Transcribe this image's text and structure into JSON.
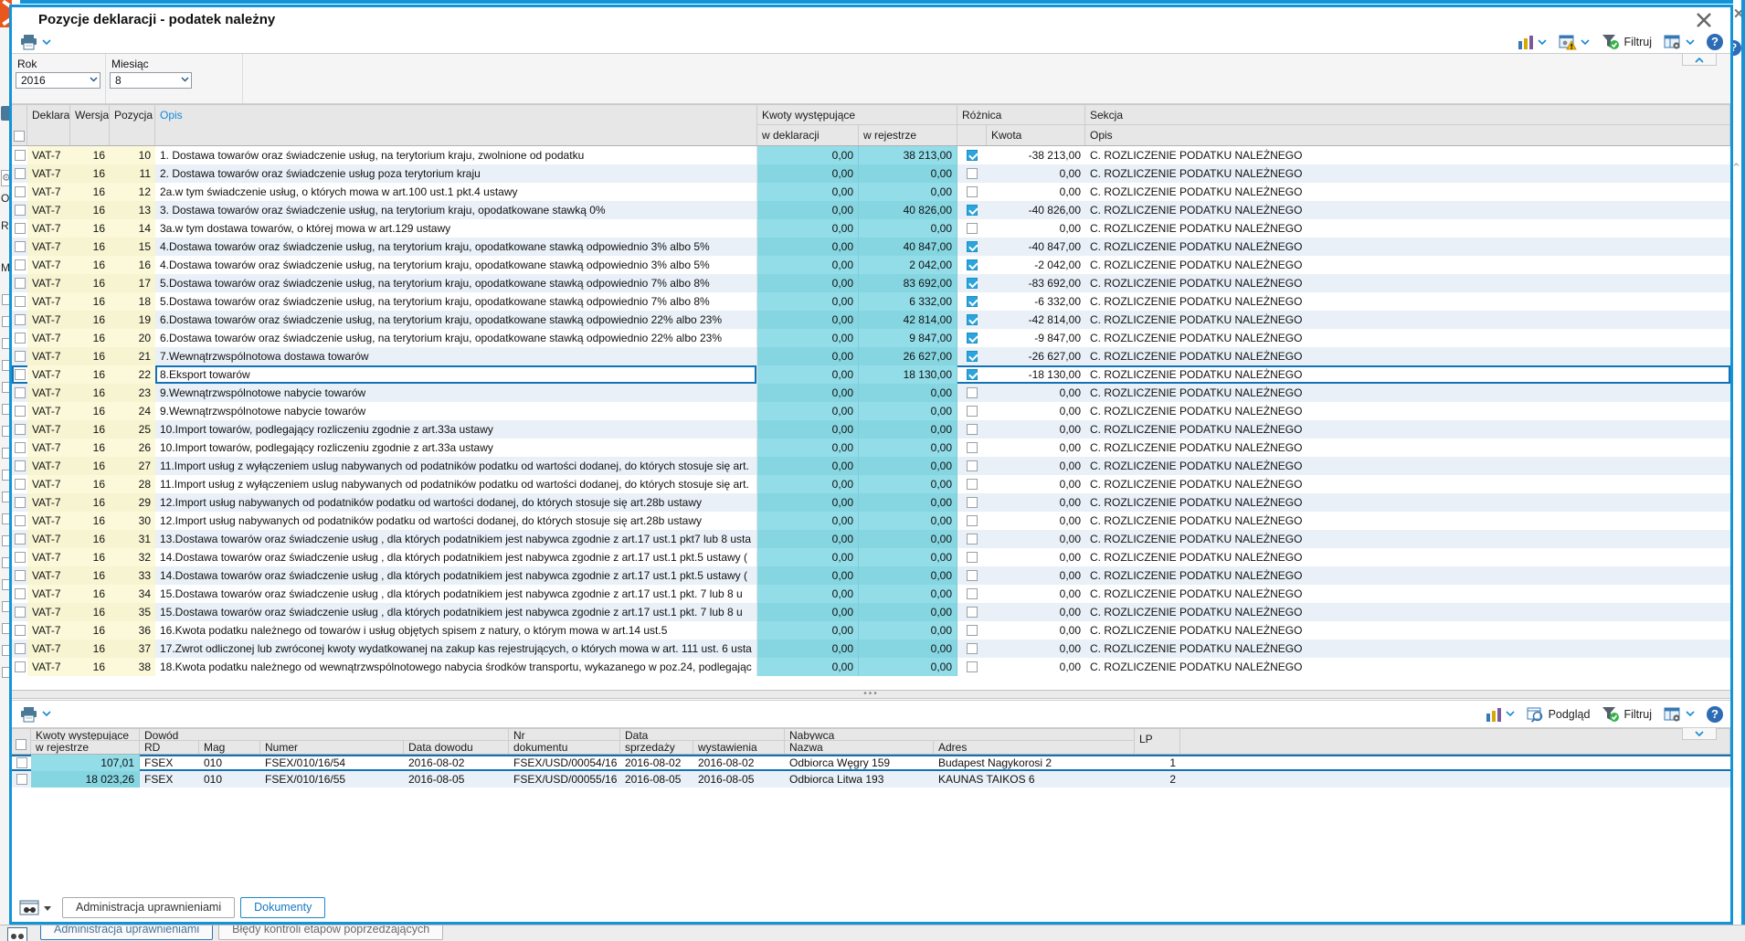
{
  "window": {
    "title": "Pozycje deklaracji - podatek należny"
  },
  "filters": {
    "year_label": "Rok",
    "year_value": "2016",
    "month_label": "Miesiąc",
    "month_value": "8"
  },
  "toolbar_top": {
    "filter_label": "Filtruj",
    "help_glyph": "?"
  },
  "toolbar_bottom": {
    "preview_label": "Podgląd",
    "filter_label": "Filtruj",
    "help_glyph": "?"
  },
  "main_table": {
    "headers": {
      "declaration": "Deklaracja",
      "version": "Wersja",
      "position": "Pozycja",
      "description": "Opis",
      "amounts_group": "Kwoty występujące",
      "in_declaration": "w deklaracji",
      "in_register": "w rejestrze",
      "difference_group": "Różnica",
      "amount": "Kwota",
      "section_group": "Sekcja",
      "section_desc": "Opis"
    },
    "defaults": {
      "declaration": "VAT-7",
      "version": "16",
      "in_declaration": "0,00",
      "section": "C. ROZLICZENIE PODATKU NALEŻNEGO"
    },
    "rows": [
      {
        "position": "10",
        "desc": "1. Dostawa towarów oraz świadczenie usług, na terytorium kraju, zwolnione od podatku",
        "in_register": "38 213,00",
        "checked": true,
        "difference": "-38 213,00"
      },
      {
        "position": "11",
        "desc": "2. Dostawa towarów oraz świadczenie usług poza terytorium  kraju",
        "in_register": "0,00",
        "checked": false,
        "difference": "0,00"
      },
      {
        "position": "12",
        "desc": "2a.w tym świadczenie usług, o których mowa w art.100  ust.1 pkt.4 ustawy",
        "in_register": "0,00",
        "checked": false,
        "difference": "0,00"
      },
      {
        "position": "13",
        "desc": "3. Dostawa towarów oraz świadczenie usług, na terytorium kraju, opodatkowane stawką 0%",
        "in_register": "40 826,00",
        "checked": true,
        "difference": "-40 826,00"
      },
      {
        "position": "14",
        "desc": "3a.w tym dostawa towarów, o której mowa w art.129 ustawy",
        "in_register": "0,00",
        "checked": false,
        "difference": "0,00"
      },
      {
        "position": "15",
        "desc": "4.Dostawa towarów oraz świadczenie usług, na terytorium kraju,  opodatkowane stawką odpowiednio 3% albo 5%",
        "in_register": "40 847,00",
        "checked": true,
        "difference": "-40 847,00"
      },
      {
        "position": "16",
        "desc": "4.Dostawa towarów oraz świadczenie usług, na terytorium kraju,  opodatkowane stawką odpowiednio 3% albo 5%",
        "in_register": "2 042,00",
        "checked": true,
        "difference": "-2 042,00"
      },
      {
        "position": "17",
        "desc": "5.Dostawa towarów oraz świadczenie usług, na terytorium kraju,  opodatkowane stawką odpowiednio 7% albo 8%",
        "in_register": "83 692,00",
        "checked": true,
        "difference": "-83 692,00"
      },
      {
        "position": "18",
        "desc": "5.Dostawa towarów oraz świadczenie usług, na terytorium kraju,  opodatkowane stawką odpowiednio 7% albo 8%",
        "in_register": "6 332,00",
        "checked": true,
        "difference": "-6 332,00"
      },
      {
        "position": "19",
        "desc": "6.Dostawa towarów oraz świadczenie usług, na terytorium kraju,  opodatkowane stawką odpowiednio 22% albo 23%",
        "in_register": "42 814,00",
        "checked": true,
        "difference": "-42 814,00"
      },
      {
        "position": "20",
        "desc": "6.Dostawa towarów oraz świadczenie usług, na terytorium kraju,  opodatkowane stawką odpowiednio 22% albo 23%",
        "in_register": "9 847,00",
        "checked": true,
        "difference": "-9 847,00"
      },
      {
        "position": "21",
        "desc": "7.Wewnątrzwspólnotowa dostawa towarów",
        "in_register": "26 627,00",
        "checked": true,
        "difference": "-26 627,00"
      },
      {
        "position": "22",
        "desc": "8.Eksport towarów",
        "in_register": "18 130,00",
        "checked": true,
        "difference": "-18 130,00",
        "selected": true
      },
      {
        "position": "23",
        "desc": "9.Wewnątrzwspólnotowe nabycie towarów",
        "in_register": "0,00",
        "checked": false,
        "difference": "0,00"
      },
      {
        "position": "24",
        "desc": "9.Wewnątrzwspólnotowe nabycie towarów",
        "in_register": "0,00",
        "checked": false,
        "difference": "0,00"
      },
      {
        "position": "25",
        "desc": "10.Import towarów, podlegający rozliczeniu zgodnie z art.33a ustawy",
        "in_register": "0,00",
        "checked": false,
        "difference": "0,00"
      },
      {
        "position": "26",
        "desc": "10.Import towarów, podlegający rozliczeniu zgodnie z art.33a ustawy",
        "in_register": "0,00",
        "checked": false,
        "difference": "0,00"
      },
      {
        "position": "27",
        "desc": "11.Import usług z wyłączeniem uslug nabywanych od podatników podatku od wartości dodanej, do których stosuje się art.",
        "in_register": "0,00",
        "checked": false,
        "difference": "0,00"
      },
      {
        "position": "28",
        "desc": "11.Import usług z wyłączeniem uslug nabywanych od podatników podatku od wartości dodanej, do których stosuje się art.",
        "in_register": "0,00",
        "checked": false,
        "difference": "0,00"
      },
      {
        "position": "29",
        "desc": "12.Import usług nabywanych od podatników podatku od wartości dodanej, do których stosuje się art.28b ustawy",
        "in_register": "0,00",
        "checked": false,
        "difference": "0,00"
      },
      {
        "position": "30",
        "desc": "12.Import usług nabywanych od podatników podatku od wartości dodanej, do których stosuje się art.28b ustawy",
        "in_register": "0,00",
        "checked": false,
        "difference": "0,00"
      },
      {
        "position": "31",
        "desc": "13.Dostawa towarów oraz świadczenie usług , dla których podatnikiem jest nabywca  zgodnie z art.17 ust.1 pkt7 lub 8 usta",
        "in_register": "0,00",
        "checked": false,
        "difference": "0,00"
      },
      {
        "position": "32",
        "desc": "14.Dostawa towarów oraz świadczenie usług , dla których podatnikiem jest nabywca  zgodnie z art.17 ust.1 pkt.5 ustawy (",
        "in_register": "0,00",
        "checked": false,
        "difference": "0,00"
      },
      {
        "position": "33",
        "desc": "14.Dostawa towarów oraz świadczenie usług , dla których podatnikiem jest nabywca  zgodnie z art.17 ust.1 pkt.5 ustawy (",
        "in_register": "0,00",
        "checked": false,
        "difference": "0,00"
      },
      {
        "position": "34",
        "desc": "15.Dostawa towarów oraz świadczenie usług , dla których podatnikiem jest nabywca  zgodnie z art.17 ust.1 pkt. 7 lub 8  u",
        "in_register": "0,00",
        "checked": false,
        "difference": "0,00"
      },
      {
        "position": "35",
        "desc": "15.Dostawa towarów oraz świadczenie usług , dla których podatnikiem jest nabywca  zgodnie z art.17 ust.1 pkt. 7 lub 8  u",
        "in_register": "0,00",
        "checked": false,
        "difference": "0,00"
      },
      {
        "position": "36",
        "desc": "16.Kwota podatku należnego od towarów i usług objętych spisem z natury, o którym mowa w art.14 ust.5",
        "in_register": "0,00",
        "checked": false,
        "difference": "0,00"
      },
      {
        "position": "37",
        "desc": "17.Zwrot odliczonej lub zwróconej kwoty wydatkowanej na zakup kas rejestrujących, o których mowa w art. 111 ust. 6 usta",
        "in_register": "0,00",
        "checked": false,
        "difference": "0,00"
      },
      {
        "position": "38",
        "desc": "18.Kwota podatku należnego od wewnątrzwspólnotowego nabycia środków transportu, wykazanego w poz.24,  podlegając",
        "in_register": "0,00",
        "checked": false,
        "difference": "0,00"
      }
    ]
  },
  "detail_table": {
    "headers": {
      "amounts_group": "Kwoty występujące",
      "in_register": "w rejestrze",
      "evidence_group": "Dowód",
      "rd": "RD",
      "mag": "Mag",
      "number": "Numer",
      "evidence_date": "Data dowodu",
      "doc_no_line1": "Nr",
      "doc_no_line2": "dokumentu",
      "date_group": "Data",
      "sale_date": "sprzedaży",
      "issue_date": "wystawienia",
      "buyer_group": "Nabywca",
      "name": "Nazwa",
      "address": "Adres",
      "lp": "LP"
    },
    "rows": [
      {
        "amount": "107,01",
        "rd": "FSEX",
        "mag": "010",
        "number": "FSEX/010/16/54",
        "evidence_date": "2016-08-02",
        "doc_no": "FSEX/USD/00054/16",
        "sale_date": "2016-08-02",
        "issue_date": "2016-08-02",
        "buyer_name": "Odbiorca Węgry 159",
        "buyer_address": "Budapest Nagykorosi 2",
        "lp": "1",
        "selected": true
      },
      {
        "amount": "18 023,26",
        "rd": "FSEX",
        "mag": "010",
        "number": "FSEX/010/16/55",
        "evidence_date": "2016-08-05",
        "doc_no": "FSEX/USD/00055/16",
        "sale_date": "2016-08-05",
        "issue_date": "2016-08-05",
        "buyer_name": "Odbiorca Litwa 193",
        "buyer_address": "KAUNAS TAIKOS 6",
        "lp": "2"
      }
    ]
  },
  "footer_tabs": {
    "admin": "Administracja uprawnieniami",
    "documents": "Dokumenty"
  },
  "background": {
    "tabs": {
      "admin": "Administracja uprawnieniami",
      "errors": "Błędy kontroli etapów poprzedzających"
    },
    "left_fragments": [
      "Ok",
      "Ro",
      "M"
    ]
  },
  "colors": {
    "accent_blue": "#1294d8",
    "cyan_cell": "#92dde8",
    "yellow_cell": "#fbf9d9",
    "selection_blue": "#1272b6",
    "checkbox_blue": "#2aa5dd"
  }
}
